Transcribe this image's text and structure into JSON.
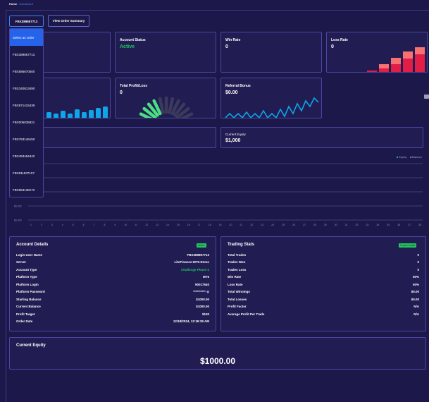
{
  "breadcrumb": {
    "home": "Home",
    "separator": " / ",
    "current": "Dashboard"
  },
  "order_select": {
    "value": "FBX389857713"
  },
  "view_summary_label": "View Order Summary",
  "dropdown_options": [
    "Select an order",
    "FBX389857713",
    "FBX586670500",
    "FBX340813490",
    "FBX971415439",
    "FBX006035821",
    "FBX783146150",
    "FBX453464442",
    "FBX811837107",
    "FBX953138172"
  ],
  "cards": {
    "account_status": {
      "title": "Account Status",
      "value": "Active"
    },
    "win_rate": {
      "title": "Win Rate",
      "value": "0"
    },
    "loss_rate": {
      "title": "Loss Rate",
      "value": "0"
    },
    "total_pl": {
      "title": "Total Profit/Loss",
      "value": "0"
    },
    "referral_bonus": {
      "title": "Referral Bonus",
      "value": "$0.00"
    },
    "current_equity": {
      "title": "Current Equity",
      "value": "$1,000"
    }
  },
  "chart_legend": {
    "equity": "Equity",
    "balance": "Balance"
  },
  "chart_data": {
    "type": "line",
    "y_ticks": [
      "$0,002",
      "$0,000"
    ],
    "x": [
      "1",
      "2",
      "3",
      "4",
      "5",
      "6",
      "7",
      "8",
      "9",
      "10",
      "11",
      "12",
      "13",
      "14",
      "15",
      "16",
      "17",
      "18",
      "19",
      "20",
      "21",
      "22",
      "23",
      "24",
      "25",
      "26",
      "27",
      "28",
      "29",
      "30",
      "31",
      "32",
      "33",
      "34",
      "35",
      "36",
      "37",
      "38"
    ]
  },
  "colors": {
    "equity": "#22d3ee",
    "balance": "#818cf8",
    "accent_blue": "#2563eb",
    "green": "#22c55e"
  },
  "account_details": {
    "title": "Account Details",
    "badge": "Active",
    "rows": [
      {
        "label": "Login User Name",
        "value": "FBX389857713"
      },
      {
        "label": "Server",
        "value": "LiteFinance-MT5-Demo"
      },
      {
        "label": "Account Type",
        "value": "Challenge Phase-2"
      },
      {
        "label": "Platform Type",
        "value": "MT5"
      },
      {
        "label": "Platform Login",
        "value": "90017540"
      },
      {
        "label": "Platform Password",
        "value": "**********"
      },
      {
        "label": "Starting Balance",
        "value": "$1000.00"
      },
      {
        "label": "Current Balance",
        "value": "$1000.00"
      },
      {
        "label": "Profit Target",
        "value": "$100"
      },
      {
        "label": "Order Date",
        "value": "12/18/2024, 12:36:39 AM"
      }
    ]
  },
  "trading_stats": {
    "title": "Trading Stats",
    "badge": "0 open trades",
    "rows": [
      {
        "label": "Total Trades",
        "value": "0"
      },
      {
        "label": "Trades Won",
        "value": "0"
      },
      {
        "label": "Trades Loss",
        "value": "0"
      },
      {
        "label": "Win Rate",
        "value": "50%"
      },
      {
        "label": "Loss Rate",
        "value": "50%"
      },
      {
        "label": "Total Winnings",
        "value": "$0.00"
      },
      {
        "label": "Total Losses",
        "value": "$0.00"
      },
      {
        "label": "Profit Factor",
        "value": "N/A"
      },
      {
        "label": "Average Profit Per Trade",
        "value": "N/A"
      }
    ]
  },
  "current_equity_panel": {
    "title": "Current Equity",
    "value": "$1000.00"
  }
}
